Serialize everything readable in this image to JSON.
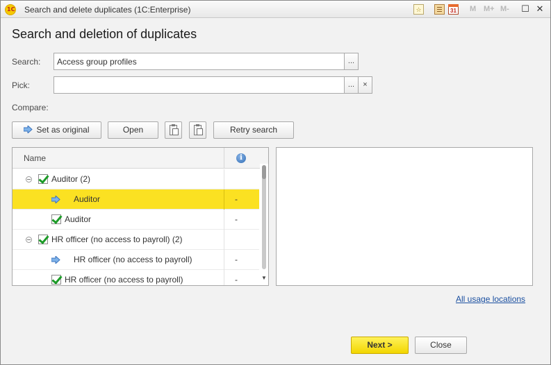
{
  "window": {
    "title": "Search and delete duplicates  (1C:Enterprise)",
    "logo_text": "1C",
    "toolbar_icons": [
      "bookmark-icon",
      "calculator-icon",
      "calendar-icon"
    ],
    "calendar_day": "31",
    "memory_buttons": [
      "M",
      "M+",
      "M-"
    ]
  },
  "form": {
    "title": "Search and deletion of duplicates",
    "search_label": "Search:",
    "search_value": "Access group profiles",
    "pick_label": "Pick:",
    "pick_value": "",
    "compare_label": "Compare:",
    "ellipsis": "...",
    "clear": "×"
  },
  "toolbar": {
    "set_as_original": "Set as original",
    "open": "Open",
    "retry_search": "Retry search"
  },
  "grid": {
    "column_name": "Name",
    "info_glyph": "i",
    "rows": [
      {
        "label": "Auditor (2)",
        "mark": ""
      },
      {
        "label": "Auditor",
        "mark": "-"
      },
      {
        "label": "Auditor",
        "mark": "-"
      },
      {
        "label": "HR officer (no access to payroll) (2)",
        "mark": ""
      },
      {
        "label": "HR officer (no access to payroll)",
        "mark": "-"
      },
      {
        "label": "HR officer (no access to payroll)",
        "mark": "-"
      }
    ]
  },
  "links": {
    "all_usage_locations": "All usage locations"
  },
  "footer": {
    "next": "Next >",
    "close": "Close"
  },
  "colors": {
    "selection": "#fbe122",
    "primary_button": "#f2d600",
    "link": "#1a4fa0",
    "check": "#1c9b27"
  }
}
